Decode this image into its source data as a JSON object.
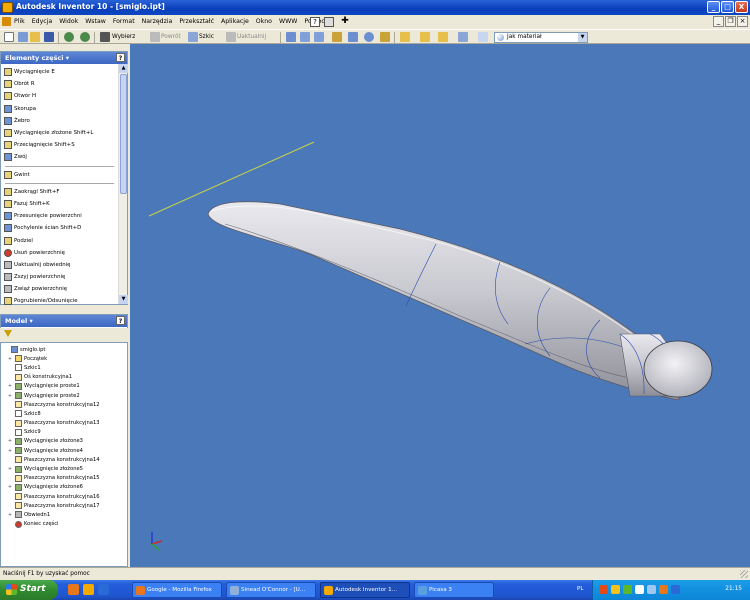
{
  "window": {
    "title": "Autodesk Inventor 10 - [smiglo.ipt]",
    "buttons": [
      "_",
      "□",
      "X"
    ]
  },
  "menu": {
    "items": [
      "Plik",
      "Edycja",
      "Widok",
      "Wstaw",
      "Format",
      "Narzędzia",
      "Przekształć",
      "Aplikacje",
      "Okno",
      "WWW",
      "Pomoc"
    ],
    "help_icon": "?"
  },
  "toolbar": {
    "select_label": "Wybierz",
    "return_label": "Powrót",
    "sketch_label": "Szkic",
    "update_label": "Uaktualnij",
    "material": "Jak materiał"
  },
  "features_panel": {
    "title": "Elementy części",
    "help": "?",
    "items": [
      {
        "label": "Wyciągnięcie    E",
        "icon": "extrude"
      },
      {
        "label": "Obrót    R",
        "icon": "revolve"
      },
      {
        "label": "Otwór    H",
        "icon": "hole"
      },
      {
        "label": "Skorupa",
        "icon": "shell"
      },
      {
        "label": "Żebro",
        "icon": "rib"
      },
      {
        "label": "Wyciągnięcie złożone    Shift+L",
        "icon": "loft"
      },
      {
        "label": "Przeciągnięcie    Shift+S",
        "icon": "sweep"
      },
      {
        "label": "Zwój",
        "icon": "coil"
      },
      {
        "label": "Gwint",
        "icon": "thread"
      },
      {
        "label": "Zaokrągl    Shift+F",
        "icon": "fillet"
      },
      {
        "label": "Fazuj    Shift+K",
        "icon": "chamfer"
      },
      {
        "label": "Przesunięcie powierzchni",
        "icon": "offset"
      },
      {
        "label": "Pochylenie ścian    Shift+D",
        "icon": "draft"
      },
      {
        "label": "Podziel",
        "icon": "split"
      },
      {
        "label": "Usuń powierzchnię",
        "icon": "delete-face"
      },
      {
        "label": "Uaktualnij obwiednię",
        "icon": "bounding"
      },
      {
        "label": "Zszyj powierzchnię",
        "icon": "stitch"
      },
      {
        "label": "Zwiąż powierzchnię",
        "icon": "sculpt"
      },
      {
        "label": "Pogrubienie/Odsunięcie",
        "icon": "thicken"
      }
    ]
  },
  "model_panel": {
    "title": "Model",
    "help": "?",
    "tree": [
      {
        "label": "smiglo.ipt",
        "icon": "part",
        "level": 0,
        "exp": ""
      },
      {
        "label": "Początek",
        "icon": "folder",
        "level": 1,
        "exp": "+"
      },
      {
        "label": "Szkic1",
        "icon": "sketch",
        "level": 1,
        "exp": ""
      },
      {
        "label": "Oś konstrukcyjna1",
        "icon": "plane",
        "level": 1,
        "exp": ""
      },
      {
        "label": "Wyciągnięcie proste1",
        "icon": "feat",
        "level": 1,
        "exp": "+"
      },
      {
        "label": "Wyciągnięcie proste2",
        "icon": "feat",
        "level": 1,
        "exp": "+"
      },
      {
        "label": "Płaszczyzna konstrukcyjna12",
        "icon": "plane",
        "level": 1,
        "exp": ""
      },
      {
        "label": "Szkic8",
        "icon": "sketch",
        "level": 1,
        "exp": ""
      },
      {
        "label": "Płaszczyzna konstrukcyjna13",
        "icon": "plane",
        "level": 1,
        "exp": ""
      },
      {
        "label": "Szkic9",
        "icon": "sketch",
        "level": 1,
        "exp": ""
      },
      {
        "label": "Wyciągnięcie złożone3",
        "icon": "feat",
        "level": 1,
        "exp": "+"
      },
      {
        "label": "Wyciągnięcie złożone4",
        "icon": "feat",
        "level": 1,
        "exp": "+"
      },
      {
        "label": "Płaszczyzna konstrukcyjna14",
        "icon": "plane",
        "level": 1,
        "exp": ""
      },
      {
        "label": "Wyciągnięcie złożone5",
        "icon": "feat",
        "level": 1,
        "exp": "+"
      },
      {
        "label": "Płaszczyzna konstrukcyjna15",
        "icon": "plane",
        "level": 1,
        "exp": ""
      },
      {
        "label": "Wyciągnięcie złożone6",
        "icon": "feat",
        "level": 1,
        "exp": "+"
      },
      {
        "label": "Płaszczyzna konstrukcyjna16",
        "icon": "plane",
        "level": 1,
        "exp": ""
      },
      {
        "label": "Płaszczyzna konstrukcyjna17",
        "icon": "plane",
        "level": 1,
        "exp": ""
      },
      {
        "label": "Obwiedn1",
        "icon": "hole",
        "level": 1,
        "exp": "+"
      },
      {
        "label": "Koniec części",
        "icon": "end",
        "level": 1,
        "exp": ""
      }
    ]
  },
  "statusbar": {
    "text": "Naciśnij F1 by uzyskać pomoc"
  },
  "taskbar": {
    "start": "Start",
    "tasks": [
      {
        "label": "Google - Mozilla Firefox",
        "color": "#e8761a"
      },
      {
        "label": "Sinead O'Connor - [U...",
        "color": "#8fb0d8"
      },
      {
        "label": "Autodesk Inventor 1...",
        "color": "#f2a900"
      },
      {
        "label": "Picasa 3",
        "color": "#5aa0e0"
      }
    ],
    "lang": "PL",
    "clock": "21:15"
  },
  "colors": {
    "viewport": "#4a78b8",
    "title_bar": "#0a3fba",
    "taskbar": "#245edb"
  }
}
